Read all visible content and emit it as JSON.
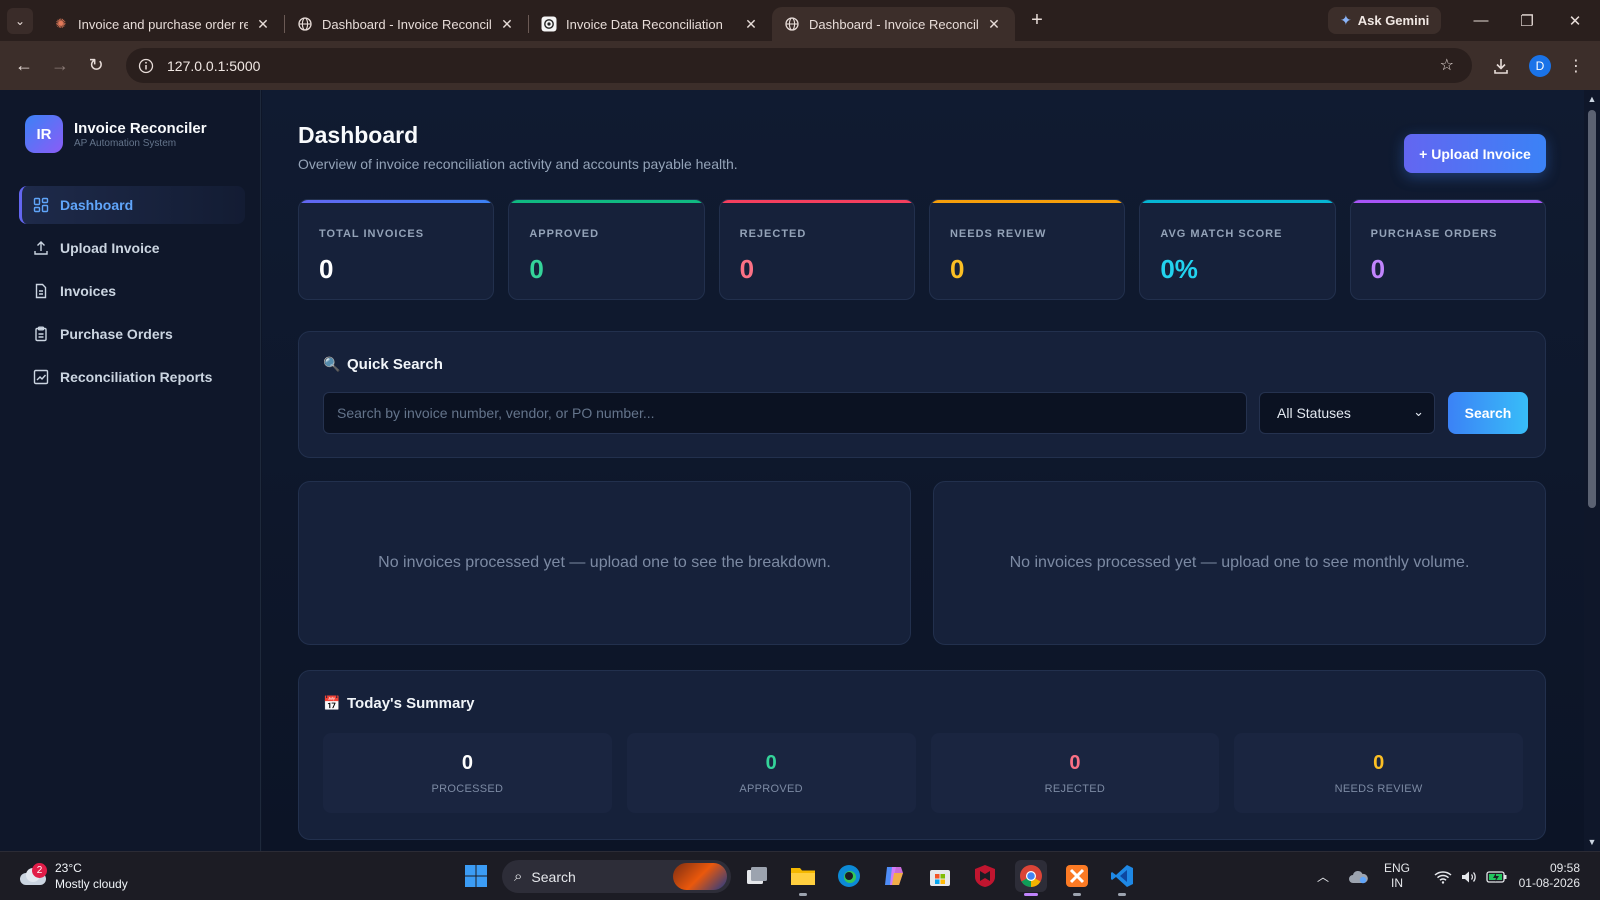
{
  "browser": {
    "tabs": [
      {
        "title": "Invoice and purchase order rec",
        "active": false,
        "favicon": "sunburst-icon"
      },
      {
        "title": "Dashboard - Invoice Reconciliat",
        "active": false,
        "favicon": "globe-icon"
      },
      {
        "title": "Invoice Data Reconciliation",
        "active": false,
        "favicon": "openai-icon"
      },
      {
        "title": "Dashboard - Invoice Reconciliat",
        "active": true,
        "favicon": "globe-icon"
      }
    ],
    "ask_gemini_label": "Ask Gemini",
    "url": "127.0.0.1:5000",
    "profile_initial": "D"
  },
  "app": {
    "brand": {
      "logo_text": "IR",
      "name": "Invoice Reconciler",
      "subtitle": "AP Automation System"
    },
    "nav": [
      {
        "label": "Dashboard",
        "icon": "grid-icon",
        "active": true
      },
      {
        "label": "Upload Invoice",
        "icon": "upload-icon",
        "active": false
      },
      {
        "label": "Invoices",
        "icon": "document-icon",
        "active": false
      },
      {
        "label": "Purchase Orders",
        "icon": "clipboard-icon",
        "active": false
      },
      {
        "label": "Reconciliation Reports",
        "icon": "chart-icon",
        "active": false
      }
    ],
    "header": {
      "title": "Dashboard",
      "subtitle": "Overview of invoice reconciliation activity and accounts payable health.",
      "upload_button": "+ Upload Invoice"
    },
    "stats": [
      {
        "label": "TOTAL INVOICES",
        "value": "0",
        "color": "#ffffff",
        "accent": "#6366f1"
      },
      {
        "label": "APPROVED",
        "value": "0",
        "color": "#34d399",
        "accent": "#10b981"
      },
      {
        "label": "REJECTED",
        "value": "0",
        "color": "#fb7185",
        "accent": "#f43f5e"
      },
      {
        "label": "NEEDS REVIEW",
        "value": "0",
        "color": "#fbbf24",
        "accent": "#f59e0b"
      },
      {
        "label": "AVG MATCH SCORE",
        "value": "0%",
        "color": "#22d3ee",
        "accent": "#06b6d4"
      },
      {
        "label": "PURCHASE ORDERS",
        "value": "0",
        "color": "#c084fc",
        "accent": "#a855f7"
      }
    ],
    "quick_search": {
      "title": "Quick Search",
      "icon": "magnifier-icon",
      "placeholder": "Search by invoice number, vendor, or PO number...",
      "status_selected": "All Statuses",
      "button": "Search"
    },
    "empty_states": {
      "breakdown": "No invoices processed yet — upload one to see the breakdown.",
      "monthly": "No invoices processed yet — upload one to see monthly volume."
    },
    "summary": {
      "title": "Today's Summary",
      "icon": "calendar-icon",
      "tiles": [
        {
          "value": "0",
          "label": "PROCESSED",
          "color": "#ffffff"
        },
        {
          "value": "0",
          "label": "APPROVED",
          "color": "#34d399"
        },
        {
          "value": "0",
          "label": "REJECTED",
          "color": "#fb7185"
        },
        {
          "value": "0",
          "label": "NEEDS REVIEW",
          "color": "#fbbf24"
        }
      ]
    }
  },
  "taskbar": {
    "weather": {
      "temp": "23°C",
      "desc": "Mostly cloudy",
      "badge": "2"
    },
    "search_label": "Search",
    "lang": {
      "line1": "ENG",
      "line2": "IN"
    },
    "clock": {
      "time": "09:58",
      "date": "01-08-2026"
    }
  }
}
